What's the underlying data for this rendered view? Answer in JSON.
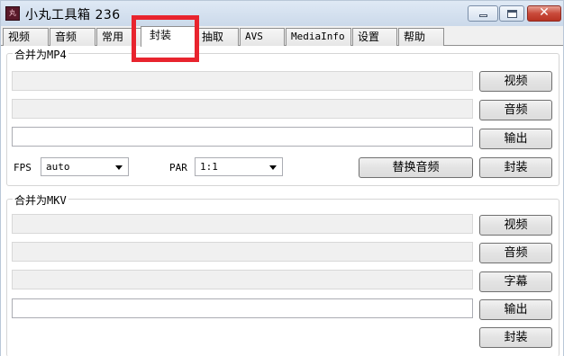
{
  "window": {
    "title": "小丸工具箱 236"
  },
  "tabs": [
    {
      "label": "视频"
    },
    {
      "label": "音频"
    },
    {
      "label": "常用"
    },
    {
      "label": "封装"
    },
    {
      "label": "抽取"
    },
    {
      "label": "AVS"
    },
    {
      "label": "MediaInfo"
    },
    {
      "label": "设置"
    },
    {
      "label": "帮助"
    }
  ],
  "active_tab": "封装",
  "mp4": {
    "group_title": "合并为MP4",
    "video_button": "视频",
    "audio_button": "音频",
    "output_button": "输出",
    "fps_label": "FPS",
    "fps_value": "auto",
    "par_label": "PAR",
    "par_value": "1:1",
    "replace_audio_button": "替换音频",
    "mux_button": "封装"
  },
  "mkv": {
    "group_title": "合并为MKV",
    "video_button": "视频",
    "audio_button": "音频",
    "subtitle_button": "字幕",
    "output_button": "输出",
    "mux_button": "封装"
  },
  "colors": {
    "highlight": "#e8242e",
    "titlebar": "#cbd9ea",
    "close_button": "#c94a3a"
  },
  "icons": [
    "app-icon",
    "minimize-icon",
    "maximize-icon",
    "close-icon",
    "chevron-down-icon"
  ]
}
